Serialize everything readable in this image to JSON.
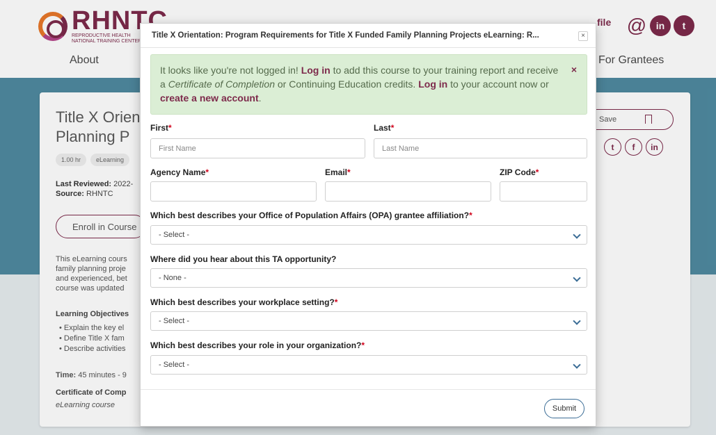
{
  "header": {
    "logo_big": "RHNTC",
    "logo_small_1": "REPRODUCTIVE HEALTH",
    "logo_small_2": "NATIONAL TRAINING CENTER",
    "nav_about": "About",
    "nav_grantees": "For Grantees",
    "profile_link": "file"
  },
  "course": {
    "title_line1": "Title X Orien",
    "title_line2": "Planning P",
    "chip_hours": "1.00 hr",
    "chip_type": "eLearning",
    "last_reviewed_label": "Last Reviewed:",
    "last_reviewed_value": "2022-",
    "source_label": "Source:",
    "source_value": "RHNTC",
    "enroll_label": "Enroll in Course",
    "save_label": "Save",
    "desc_lines": [
      "This eLearning cours",
      "family planning proje",
      "and experienced, bet",
      "course was updated"
    ],
    "learning_objectives_label": "Learning Objectives",
    "objectives": [
      "Explain the key el",
      "Define Title X fam",
      "Describe activities"
    ],
    "time_label": "Time:",
    "time_value": "45 minutes - 9",
    "cert_label": "Certificate of Comp",
    "cert_sub": "eLearning course"
  },
  "modal": {
    "title": "Title X Orientation: Program Requirements for Title X Funded Family Planning Projects eLearning: R...",
    "close": "×",
    "alert": {
      "t1": "It looks like you're not logged in! ",
      "login1": "Log in",
      "t2": " to add this course to your training report and receive a ",
      "cert": "Certificate of Completion",
      "t3": " or Continuing Education credits. ",
      "login2": "Log in",
      "t4": " to your account now or ",
      "create": "create a new account",
      "t5": ".",
      "close": "×"
    },
    "first_label": "First",
    "first_placeholder": "First Name",
    "last_label": "Last",
    "last_placeholder": "Last Name",
    "agency_label": "Agency Name",
    "email_label": "Email",
    "zip_label": "ZIP Code",
    "required_mark": "*",
    "q1_label": "Which best describes your Office of Population Affairs (OPA) grantee affiliation?",
    "q1_value": "- Select -",
    "q2_label": "Where did you hear about this TA opportunity?",
    "q2_value": "- None -",
    "q3_label": "Which best describes your workplace setting?",
    "q3_value": "- Select -",
    "q4_label": "Which best describes your role in your organization?",
    "q4_value": "- Select -",
    "submit_label": "Submit"
  },
  "colors": {
    "brand": "#7d2a4b",
    "teal_band": "#4f8aa0",
    "alert_bg": "#dbeed5",
    "required": "#d0021b",
    "chevron": "#3b6d96"
  }
}
